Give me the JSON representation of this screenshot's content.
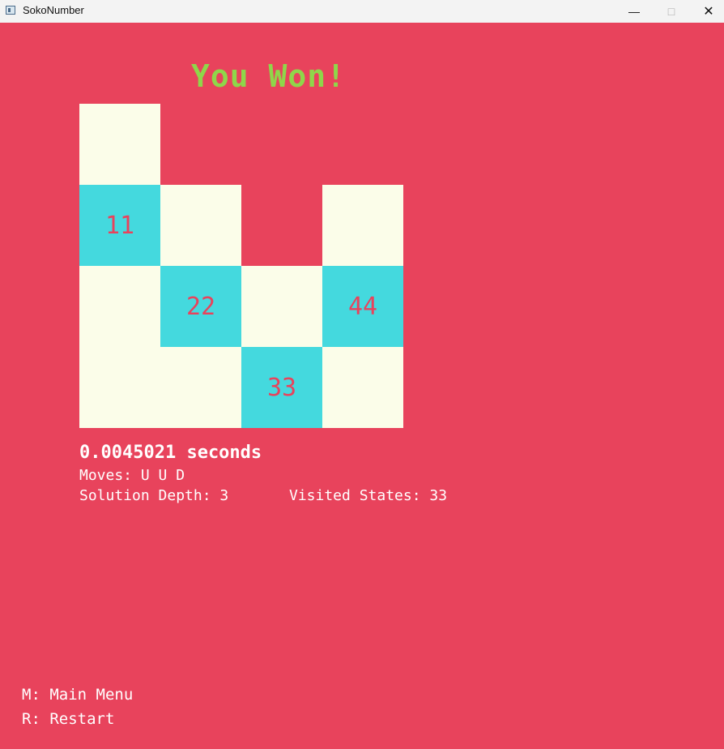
{
  "window": {
    "title": "SokoNumber",
    "controls": {
      "minimize": "—",
      "maximize": "□",
      "close": "✕"
    }
  },
  "game": {
    "status_text": "You Won!",
    "board": {
      "tiles": [
        {
          "row": 0,
          "col": 0,
          "type": "floor",
          "label": ""
        },
        {
          "row": 1,
          "col": 0,
          "type": "box",
          "label": "11"
        },
        {
          "row": 1,
          "col": 1,
          "type": "floor",
          "label": ""
        },
        {
          "row": 1,
          "col": 3,
          "type": "floor",
          "label": ""
        },
        {
          "row": 2,
          "col": 0,
          "type": "floor",
          "label": ""
        },
        {
          "row": 2,
          "col": 1,
          "type": "box",
          "label": "22"
        },
        {
          "row": 2,
          "col": 2,
          "type": "floor",
          "label": ""
        },
        {
          "row": 2,
          "col": 3,
          "type": "box",
          "label": "44"
        },
        {
          "row": 3,
          "col": 0,
          "type": "floor",
          "label": ""
        },
        {
          "row": 3,
          "col": 1,
          "type": "floor",
          "label": ""
        },
        {
          "row": 3,
          "col": 2,
          "type": "box",
          "label": "33"
        },
        {
          "row": 3,
          "col": 3,
          "type": "floor",
          "label": ""
        }
      ]
    },
    "stats": {
      "time": "0.0045021 seconds",
      "moves": "Moves:  U U D",
      "solution_depth": "Solution Depth: 3",
      "visited_states": "Visited States: 33"
    },
    "hints": {
      "main_menu": "M: Main Menu",
      "restart": "R: Restart"
    }
  },
  "colors": {
    "background": "#e8435c",
    "floor": "#fbfde9",
    "box": "#44d9de",
    "won_text": "#8fd64a",
    "box_number": "#e8435c"
  }
}
